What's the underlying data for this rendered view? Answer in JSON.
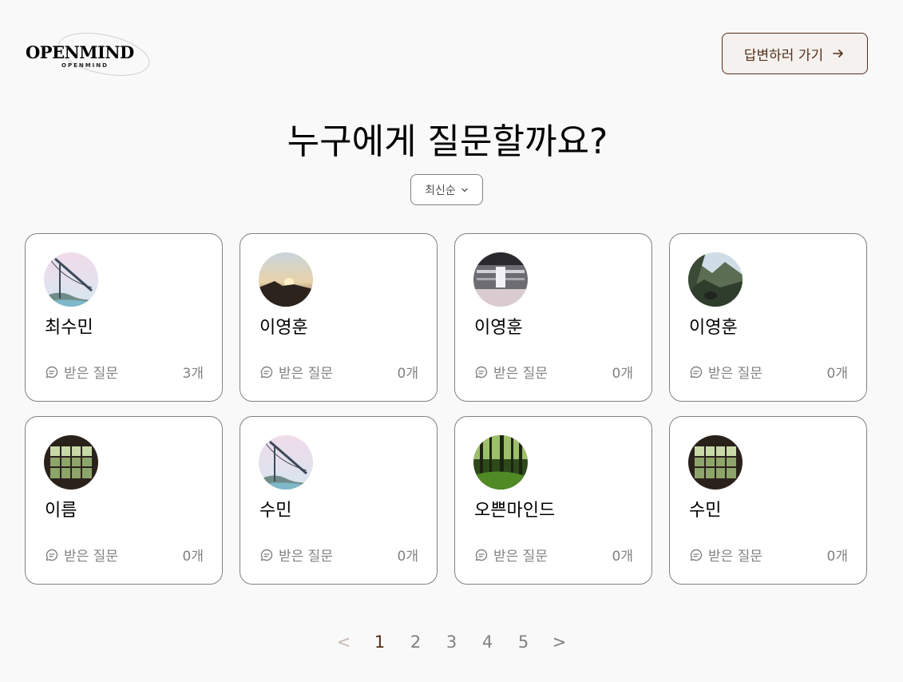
{
  "header": {
    "logo_text": "OPENMIND",
    "logo_subtext": "OPENMIND",
    "answer_button_label": "답변하러 가기"
  },
  "main": {
    "title": "누구에게 질문할까요?",
    "sort_label": "최신순"
  },
  "cards": [
    {
      "name": "최수민",
      "questions_label": "받은 질문",
      "count": "3개",
      "avatar": "bridge"
    },
    {
      "name": "이영훈",
      "questions_label": "받은 질문",
      "count": "0개",
      "avatar": "sunset"
    },
    {
      "name": "이영훈",
      "questions_label": "받은 질문",
      "count": "0개",
      "avatar": "train"
    },
    {
      "name": "이영훈",
      "questions_label": "받은 질문",
      "count": "0개",
      "avatar": "mountain"
    },
    {
      "name": "이름",
      "questions_label": "받은 질문",
      "count": "0개",
      "avatar": "window"
    },
    {
      "name": "수민",
      "questions_label": "받은 질문",
      "count": "0개",
      "avatar": "bridge"
    },
    {
      "name": "오쁜마인드",
      "questions_label": "받은 질문",
      "count": "0개",
      "avatar": "forest"
    },
    {
      "name": "수민",
      "questions_label": "받은 질문",
      "count": "0개",
      "avatar": "window"
    }
  ],
  "pagination": {
    "prev": "<",
    "pages": [
      "1",
      "2",
      "3",
      "4",
      "5"
    ],
    "next": ">",
    "current": "1"
  },
  "colors": {
    "brown": "#542f1a",
    "gray": "#818181",
    "background": "#f9f9f9"
  }
}
